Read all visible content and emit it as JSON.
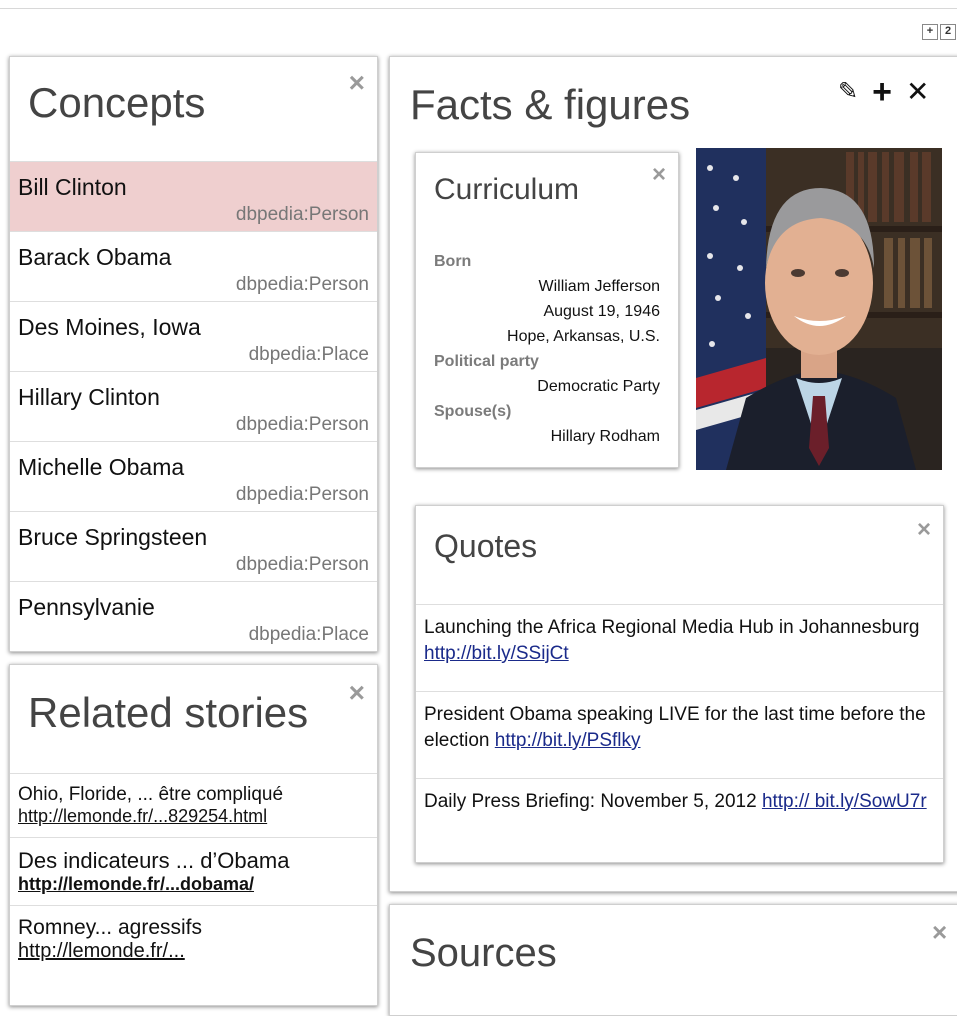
{
  "toolbar": {
    "expand_glyph": "+",
    "other_glyph": "2"
  },
  "concepts": {
    "title": "Concepts",
    "close_icon": "×",
    "items": [
      {
        "name": "Bill Clinton",
        "type": "dbpedia:Person",
        "selected": true
      },
      {
        "name": "Barack Obama",
        "type": "dbpedia:Person"
      },
      {
        "name": "Des Moines, Iowa",
        "type": "dbpedia:Place"
      },
      {
        "name": "Hillary Clinton",
        "type": "dbpedia:Person"
      },
      {
        "name": "Michelle Obama",
        "type": "dbpedia:Person"
      },
      {
        "name": "Bruce Springsteen",
        "type": "dbpedia:Person"
      },
      {
        "name": "Pennsylvanie",
        "type": "dbpedia:Place"
      }
    ]
  },
  "related": {
    "title": "Related stories",
    "close_icon": "×",
    "items": [
      {
        "title": "Ohio, Floride, ... être compliqué",
        "link": "http://lemonde.fr/...829254.html"
      },
      {
        "title": "Des indicateurs ... d’Obama",
        "link": "http://lemonde.fr/...dobama/"
      },
      {
        "title": "Romney... agressifs",
        "link": "http://lemonde.fr/..."
      }
    ]
  },
  "facts": {
    "title": "Facts & figures",
    "tools": {
      "edit_icon": "✎",
      "add_icon": "+",
      "close_icon": "✕"
    }
  },
  "curriculum": {
    "title": "Curriculum",
    "close_icon": "×",
    "born_label": "Born",
    "born_lines": [
      "William Jefferson",
      "August 19, 1946",
      "Hope, Arkansas, U.S."
    ],
    "party_label": "Political party",
    "party_value": "Democratic Party",
    "spouse_label": "Spouse(s)",
    "spouse_value": "Hillary Rodham"
  },
  "quotes": {
    "title": "Quotes",
    "close_icon": "×",
    "items": [
      {
        "text": "Launching the Africa Regional Media Hub in Johannesburg ",
        "link": "http://bit.ly/SSijCt "
      },
      {
        "text": "President Obama speaking LIVE for the last time before the election ",
        "link": "http://bit.ly/PSflky "
      },
      {
        "text": "Daily Press Briefing: November 5, 2012 ",
        "link": "http:// bit.ly/SowU7r "
      }
    ]
  },
  "sources": {
    "title": "Sources",
    "close_icon": "×"
  }
}
